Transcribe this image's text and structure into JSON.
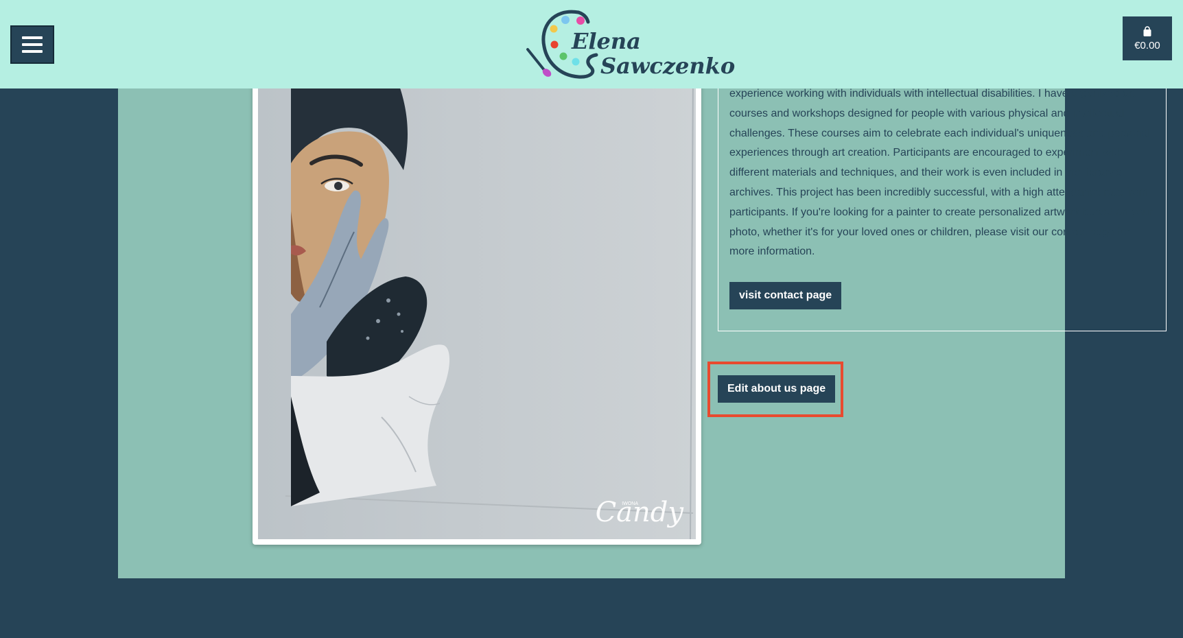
{
  "header": {
    "logo_line1": "Elena",
    "logo_line2": "Sawczenko",
    "cart_total": "€0.00"
  },
  "about": {
    "text": "experience working with individuals with intellectual disabilities. I have organized art courses and workshops designed for people with various physical and intellectual challenges. These courses aim to celebrate each individual's uniqueness and personal experiences through art creation. Participants are encouraged to experiment with different materials and techniques, and their work is even included in the library's archives. This project has been incredibly successful, with a high attendance rate from participants. If you're looking for a painter to create personalized artwork based on your photo, whether it's for your loved ones or children, please visit our contact page for more information.",
    "contact_button": "visit contact page"
  },
  "admin": {
    "edit_button": "Edit about us page"
  },
  "painting": {
    "watermark": "Candy",
    "watermark_small": "IWONA"
  },
  "colors": {
    "header_bg": "#b5efe2",
    "page_bg": "#264457",
    "panel_bg": "#8cc0b4",
    "button_bg": "#264457",
    "highlight": "#e84a2f"
  }
}
